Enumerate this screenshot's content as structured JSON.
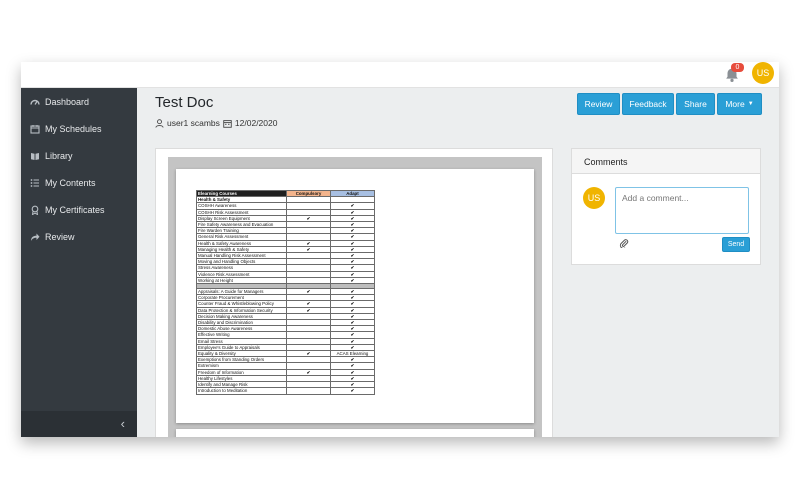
{
  "topbar": {
    "notification_count": "0",
    "user_initials": "US"
  },
  "sidebar": {
    "items": [
      {
        "label": "Dashboard",
        "icon": "dashboard-icon"
      },
      {
        "label": "My Schedules",
        "icon": "calendar-icon"
      },
      {
        "label": "Library",
        "icon": "book-icon"
      },
      {
        "label": "My Contents",
        "icon": "list-icon"
      },
      {
        "label": "My Certificates",
        "icon": "award-icon"
      },
      {
        "label": "Review",
        "icon": "share-icon"
      }
    ]
  },
  "document": {
    "title": "Test Doc",
    "author": "user1 scambs",
    "date": "12/02/2020"
  },
  "actions": {
    "review": "Review",
    "feedback": "Feedback",
    "share": "Share",
    "more": "More"
  },
  "comments": {
    "title": "Comments",
    "avatar_initials": "US",
    "placeholder": "Add a comment...",
    "send": "Send"
  },
  "colors": {
    "accent": "#2a9fd6",
    "sidebar": "#343a40",
    "avatar": "#f0b400",
    "badge": "#e74c3c"
  },
  "document_preview": {
    "headers": [
      "Elearning Courses",
      "Compulsory",
      "Adapt"
    ],
    "rows": [
      {
        "type": "section",
        "name": "Health & Safety",
        "compulsory": "",
        "adapt": ""
      },
      {
        "name": "COSHH Awareness",
        "compulsory": "",
        "adapt": "✔"
      },
      {
        "name": "COSHH Risk Assessment",
        "compulsory": "",
        "adapt": "✔"
      },
      {
        "name": "Display Screen Equipment",
        "compulsory": "✔",
        "adapt": "✔"
      },
      {
        "name": "Fire Safety Awareness and Evacuation",
        "compulsory": "",
        "adapt": "✔"
      },
      {
        "name": "Fire Warden Training",
        "compulsory": "",
        "adapt": "✔"
      },
      {
        "name": "General Risk Assessment",
        "compulsory": "",
        "adapt": "✔"
      },
      {
        "name": "Health & Safety Awareness",
        "compulsory": "✔",
        "adapt": "✔"
      },
      {
        "name": "Managing Health & Safety",
        "compulsory": "✔",
        "adapt": "✔"
      },
      {
        "name": "Manual Handling Risk Assessment",
        "compulsory": "",
        "adapt": "✔"
      },
      {
        "name": "Moving and Handling Objects",
        "compulsory": "",
        "adapt": "✔"
      },
      {
        "name": "Stress Awareness",
        "compulsory": "",
        "adapt": "✔"
      },
      {
        "name": "Violence Risk Assessment",
        "compulsory": "",
        "adapt": "✔"
      },
      {
        "name": "Working at Height",
        "compulsory": "",
        "adapt": "✔"
      },
      {
        "type": "spacer",
        "name": "",
        "compulsory": "",
        "adapt": ""
      },
      {
        "name": "Appraisals: A Guide for Managers",
        "compulsory": "✔",
        "adapt": "✔"
      },
      {
        "name": "Corporate Procurement",
        "compulsory": "",
        "adapt": "✔"
      },
      {
        "name": "Counter Fraud & Whistleblowing Policy",
        "compulsory": "✔",
        "adapt": "✔"
      },
      {
        "name": "Data Protection & Information Security",
        "compulsory": "✔",
        "adapt": "✔"
      },
      {
        "name": "Decision Making Awareness",
        "compulsory": "",
        "adapt": "✔"
      },
      {
        "name": "Disability and Discrimination",
        "compulsory": "",
        "adapt": "✔"
      },
      {
        "name": "Domestic Abuse Awareness",
        "compulsory": "",
        "adapt": "✔"
      },
      {
        "name": "Effective Writing",
        "compulsory": "",
        "adapt": "✔"
      },
      {
        "name": "Email Stress",
        "compulsory": "",
        "adapt": "✔"
      },
      {
        "name": "Employee's Guide to Appraisals",
        "compulsory": "",
        "adapt": "✔"
      },
      {
        "name": "Equality & Diversity",
        "compulsory": "✔",
        "adapt": "ACAS Elearning"
      },
      {
        "name": "Exemptions from Standing Orders",
        "compulsory": "",
        "adapt": "✔"
      },
      {
        "name": "Extremism",
        "compulsory": "",
        "adapt": "✔"
      },
      {
        "name": "Freedom of Information",
        "compulsory": "✔",
        "adapt": "✔"
      },
      {
        "name": "Healthy Lifestyles",
        "compulsory": "",
        "adapt": "✔"
      },
      {
        "name": "Identify and Manage Risk",
        "compulsory": "",
        "adapt": "✔"
      },
      {
        "name": "Introduction to Meditation",
        "compulsory": "",
        "adapt": "✔"
      }
    ]
  }
}
